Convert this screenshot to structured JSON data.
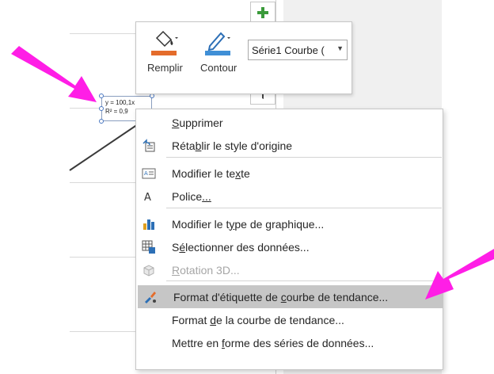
{
  "toolbar": {
    "fill_label": "Remplir",
    "outline_label": "Contour",
    "series_value": "Série1 Courbe ("
  },
  "trendline_label": {
    "line1": "y = 100,1x",
    "line2": "R² = 0,9"
  },
  "context_menu": {
    "items": [
      {
        "pre": "",
        "key": "S",
        "post": "upprimer",
        "icon": "none",
        "enabled": true
      },
      {
        "pre": "Réta",
        "key": "b",
        "post": "lir le style d'origine",
        "icon": "reset-style-icon",
        "enabled": true
      },
      {
        "pre": "Modifier le te",
        "key": "x",
        "post": "te",
        "icon": "edit-text-icon",
        "enabled": true
      },
      {
        "pre": "Police",
        "key": "...",
        "post": "",
        "icon": "font-icon",
        "enabled": true
      },
      {
        "pre": "Modifier le t",
        "key": "y",
        "post": "pe de graphique...",
        "icon": "change-chart-type-icon",
        "enabled": true
      },
      {
        "pre": "S",
        "key": "é",
        "post": "lectionner des données...",
        "icon": "select-data-icon",
        "enabled": true
      },
      {
        "pre": "",
        "key": "R",
        "post": "otation 3D...",
        "icon": "rotation-3d-icon",
        "enabled": false
      },
      {
        "pre": "Format d'étiquette de ",
        "key": "c",
        "post": "ourbe de tendance...",
        "icon": "format-icon",
        "enabled": true
      },
      {
        "pre": "Format ",
        "key": "d",
        "post": "e la courbe de tendance...",
        "icon": "none",
        "enabled": true
      },
      {
        "pre": "Mettre en ",
        "key": "f",
        "post": "orme des séries de données...",
        "icon": "none",
        "enabled": true
      }
    ]
  },
  "colors": {
    "annotation_arrow": "#ff1ee6",
    "fill_swatch": "#e46c2b",
    "outline_swatch": "#3f8fd6",
    "highlight": "#c6c6c6",
    "plus_green": "#3a9a3a"
  }
}
